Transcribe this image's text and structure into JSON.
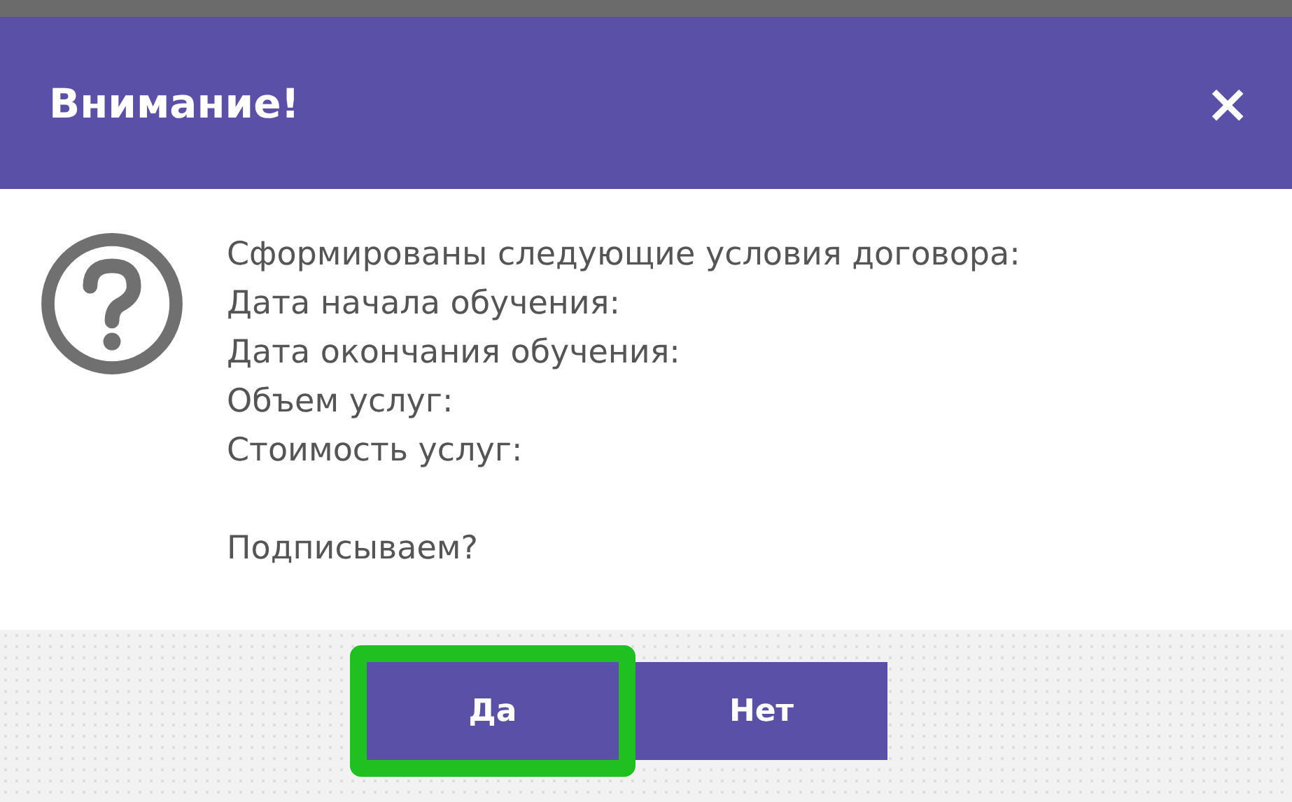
{
  "dialog": {
    "title": "Внимание!",
    "close": "×",
    "lines": [
      "Сформированы следующие условия договора:",
      "Дата начала обучения:",
      "Дата окончания обучения:",
      "Объем услуг:",
      "Стоимость услуг:"
    ],
    "question": "Подписываем?",
    "buttons": [
      {
        "label": "Да",
        "highlighted": true
      },
      {
        "label": "Нет",
        "highlighted": false
      }
    ]
  }
}
